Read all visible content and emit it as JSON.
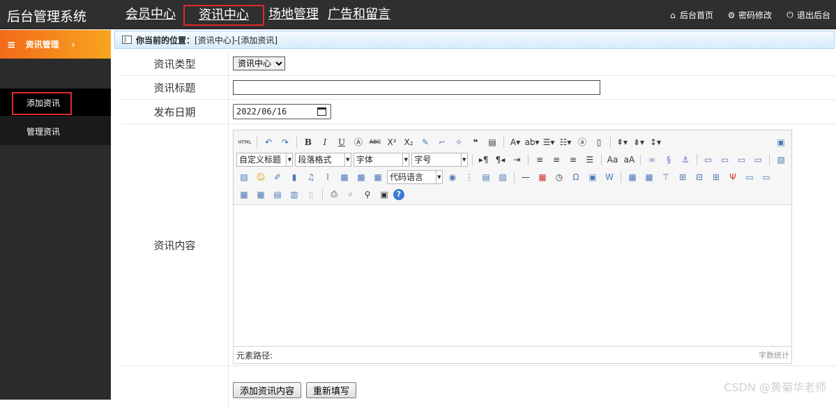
{
  "app": {
    "title": "后台管理系统"
  },
  "nav": {
    "items": [
      {
        "label": "会员中心",
        "active": false
      },
      {
        "label": "资讯中心",
        "active": true
      },
      {
        "label": "场地管理",
        "active": false
      },
      {
        "label": "广告和留言",
        "active": false
      }
    ]
  },
  "top_links": [
    {
      "icon": "home-icon",
      "label": "后台首页"
    },
    {
      "icon": "gear-icon",
      "label": "密码修改"
    },
    {
      "icon": "power-icon",
      "label": "退出后台"
    }
  ],
  "sidebar": {
    "section": {
      "label": "资讯管理",
      "chevron": "›"
    },
    "items": [
      {
        "label": "添加资讯",
        "selected": true
      },
      {
        "label": "管理资讯",
        "selected": false
      }
    ]
  },
  "breadcrumb": {
    "prefix": "你当前的位置：",
    "path": "[资讯中心]-[添加资讯]"
  },
  "form": {
    "type_label": "资讯类型",
    "type_value": "资讯中心",
    "title_label": "资讯标题",
    "title_value": "",
    "date_label": "发布日期",
    "date_value": "2022/06/16",
    "content_label": "资讯内容"
  },
  "editor": {
    "combos": {
      "custom_heading": "自定义标题",
      "paragraph": "段落格式",
      "font": "字体",
      "font_size": "字号",
      "code_lang": "代码语言"
    },
    "status_path": "元素路径:",
    "word_count": "字数统计"
  },
  "buttons": {
    "submit": "添加资讯内容",
    "reset": "重新填写"
  },
  "watermark": "CSDN @黄菊华老师",
  "colors": {
    "topbar": "#2f2f2f",
    "accent": "#f36a1a",
    "highlight_box": "#e02b2b"
  }
}
